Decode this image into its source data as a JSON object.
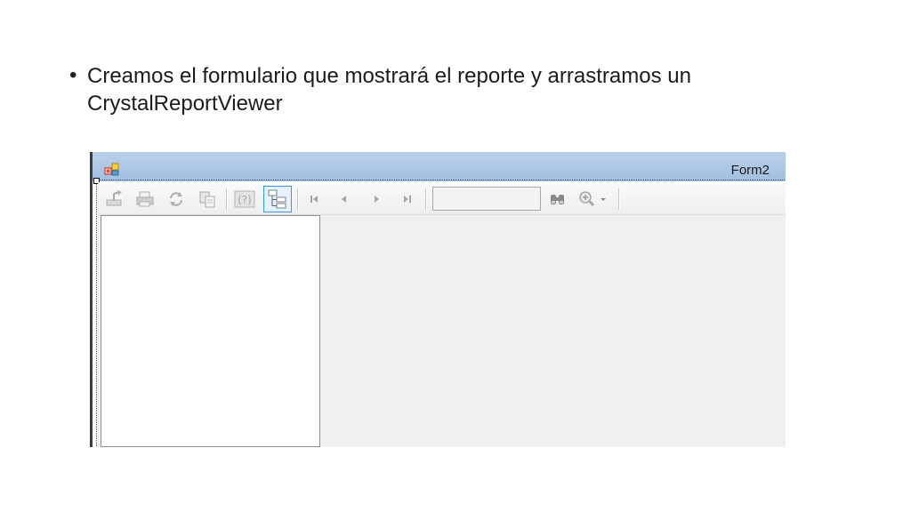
{
  "slide": {
    "bullet_text": "Creamos el formulario que mostrará el reporte y arrastramos un CrystalReportViewer"
  },
  "window": {
    "title": "Form2",
    "titlebar_color": "#a9c4e4"
  },
  "toolbar": {
    "page_input_value": "",
    "buttons": [
      {
        "name": "export-icon",
        "enabled": false
      },
      {
        "name": "print-icon",
        "enabled": false
      },
      {
        "name": "refresh-icon",
        "enabled": false
      },
      {
        "name": "copy-icon",
        "enabled": false
      },
      {
        "name": "help-icon",
        "enabled": false
      },
      {
        "name": "group-tree-icon",
        "enabled": true,
        "toggled": true
      },
      {
        "name": "first-page-icon",
        "enabled": false
      },
      {
        "name": "previous-page-icon",
        "enabled": false
      },
      {
        "name": "next-page-icon",
        "enabled": false
      },
      {
        "name": "last-page-icon",
        "enabled": false
      },
      {
        "name": "find-icon",
        "enabled": false
      },
      {
        "name": "zoom-icon",
        "enabled": false
      }
    ]
  },
  "colors": {
    "toggle_border": "#3399ff",
    "disabled_icon": "#b4b4b4",
    "client_bg": "#f0f0f0"
  }
}
